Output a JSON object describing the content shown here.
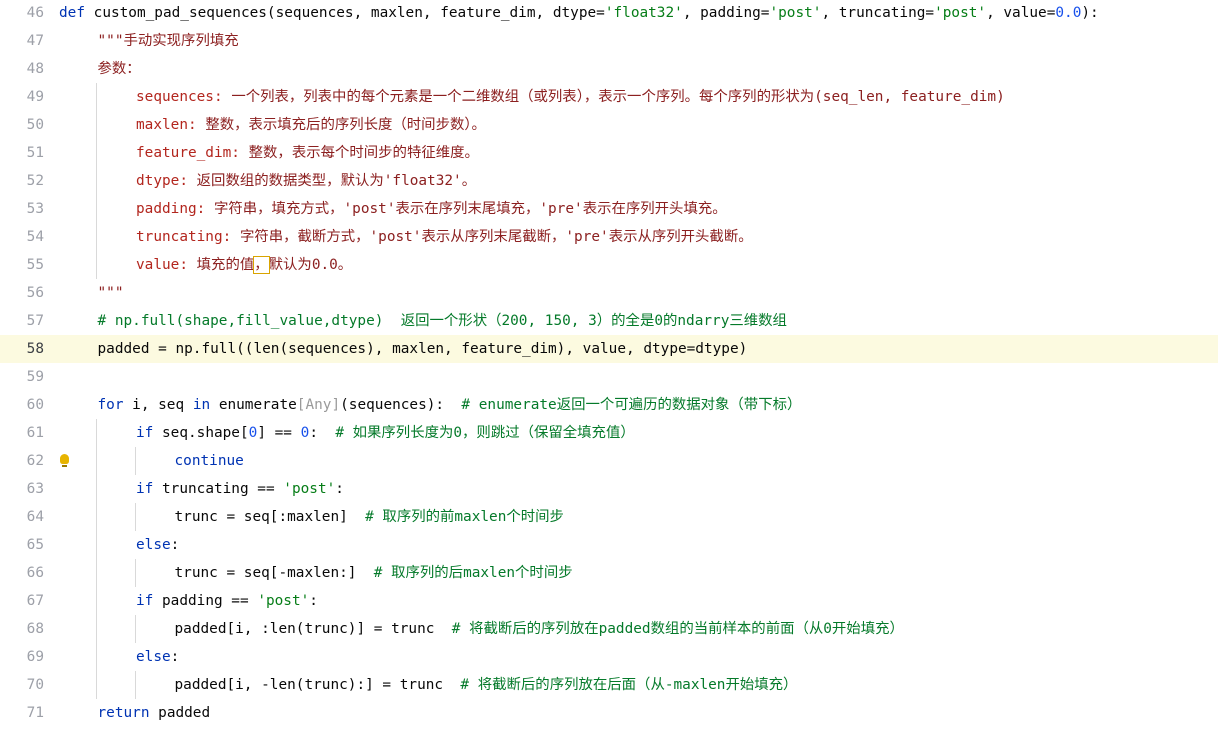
{
  "editor": {
    "current_line": 62,
    "lines": [
      {
        "num": "46",
        "indent": 0,
        "tokens": [
          {
            "t": "def ",
            "c": "kw"
          },
          {
            "t": "custom_pad_sequences(sequences, maxlen, feature_dim, dtype=",
            "c": "plain"
          },
          {
            "t": "'float32'",
            "c": "str"
          },
          {
            "t": ", padding=",
            "c": "plain"
          },
          {
            "t": "'post'",
            "c": "str"
          },
          {
            "t": ", truncating=",
            "c": "plain"
          },
          {
            "t": "'post'",
            "c": "str"
          },
          {
            "t": ", value=",
            "c": "plain"
          },
          {
            "t": "0.0",
            "c": "num"
          },
          {
            "t": "):",
            "c": "plain"
          }
        ]
      },
      {
        "num": "47",
        "indent": 1,
        "tokens": [
          {
            "t": "\"\"\"手动实现序列填充",
            "c": "doc"
          }
        ]
      },
      {
        "num": "48",
        "indent": 1,
        "tokens": [
          {
            "t": "参数：",
            "c": "doc"
          }
        ]
      },
      {
        "num": "49",
        "indent": 2,
        "tokens": [
          {
            "t": "sequences: ",
            "c": "dockey"
          },
          {
            "t": "一个列表，列表中的每个元素是一个二维数组（或列表），表示一个序列。每个序列的形状为(seq_len, feature_dim)",
            "c": "doc"
          }
        ]
      },
      {
        "num": "50",
        "indent": 2,
        "tokens": [
          {
            "t": "maxlen: ",
            "c": "dockey"
          },
          {
            "t": "整数，表示填充后的序列长度（时间步数）。",
            "c": "doc"
          }
        ]
      },
      {
        "num": "51",
        "indent": 2,
        "tokens": [
          {
            "t": "feature_dim: ",
            "c": "dockey"
          },
          {
            "t": "整数，表示每个时间步的特征维度。",
            "c": "doc"
          }
        ]
      },
      {
        "num": "52",
        "indent": 2,
        "tokens": [
          {
            "t": "dtype: ",
            "c": "dockey"
          },
          {
            "t": "返回数组的数据类型，默认为'float32'。",
            "c": "doc"
          }
        ]
      },
      {
        "num": "53",
        "indent": 2,
        "tokens": [
          {
            "t": "padding: ",
            "c": "dockey"
          },
          {
            "t": "字符串，填充方式，'post'表示在序列末尾填充，'pre'表示在序列开头填充。",
            "c": "doc"
          }
        ]
      },
      {
        "num": "54",
        "indent": 2,
        "tokens": [
          {
            "t": "truncating: ",
            "c": "dockey"
          },
          {
            "t": "字符串，截断方式，'post'表示从序列末尾截断，'pre'表示从序列开头截断。",
            "c": "doc"
          }
        ]
      },
      {
        "num": "55",
        "indent": 2,
        "tokens": [
          {
            "t": "value: ",
            "c": "dockey"
          },
          {
            "t": "填充的值",
            "c": "doc"
          },
          {
            "t": "，",
            "c": "doc",
            "box": true
          },
          {
            "t": "默认为0.0。",
            "c": "doc"
          }
        ]
      },
      {
        "num": "56",
        "indent": 1,
        "tokens": [
          {
            "t": "\"\"\"",
            "c": "doc"
          }
        ]
      },
      {
        "num": "57",
        "indent": 1,
        "tokens": [
          {
            "t": "# np.full(shape,fill_value,dtype)  返回一个形状（200, 150, 3）的全是0的ndarry三维数组",
            "c": "cmt"
          }
        ]
      },
      {
        "num": "58",
        "indent": 1,
        "highlight": true,
        "tokens": [
          {
            "t": "padded = np.full((len(sequences), maxlen, feature_dim), value, dtype=dtype)",
            "c": "plain"
          }
        ]
      },
      {
        "num": "59",
        "indent": 0,
        "tokens": []
      },
      {
        "num": "60",
        "indent": 1,
        "tokens": [
          {
            "t": "for ",
            "c": "kw"
          },
          {
            "t": "i, seq ",
            "c": "plain"
          },
          {
            "t": "in ",
            "c": "kw"
          },
          {
            "t": "enumerate",
            "c": "plain"
          },
          {
            "t": "[Any]",
            "c": "typehint"
          },
          {
            "t": "(sequences):  ",
            "c": "plain"
          },
          {
            "t": "# enumerate返回一个可遍历的数据对象（带下标）",
            "c": "cmt"
          }
        ]
      },
      {
        "num": "61",
        "indent": 2,
        "tokens": [
          {
            "t": "if ",
            "c": "kw"
          },
          {
            "t": "seq.shape[",
            "c": "plain"
          },
          {
            "t": "0",
            "c": "num"
          },
          {
            "t": "] == ",
            "c": "plain"
          },
          {
            "t": "0",
            "c": "num"
          },
          {
            "t": ":  ",
            "c": "plain"
          },
          {
            "t": "# 如果序列长度为0，则跳过（保留全填充值）",
            "c": "cmt"
          }
        ]
      },
      {
        "num": "62",
        "indent": 3,
        "tokens": [
          {
            "t": "continue",
            "c": "kw"
          }
        ]
      },
      {
        "num": "63",
        "indent": 2,
        "tokens": [
          {
            "t": "if ",
            "c": "kw"
          },
          {
            "t": "truncating == ",
            "c": "plain"
          },
          {
            "t": "'post'",
            "c": "str"
          },
          {
            "t": ":",
            "c": "plain"
          }
        ]
      },
      {
        "num": "64",
        "indent": 3,
        "tokens": [
          {
            "t": "trunc = seq[:maxlen]  ",
            "c": "plain"
          },
          {
            "t": "# 取序列的前maxlen个时间步",
            "c": "cmt"
          }
        ]
      },
      {
        "num": "65",
        "indent": 2,
        "tokens": [
          {
            "t": "else",
            "c": "kw"
          },
          {
            "t": ":",
            "c": "plain"
          }
        ]
      },
      {
        "num": "66",
        "indent": 3,
        "tokens": [
          {
            "t": "trunc = seq[-maxlen:]  ",
            "c": "plain"
          },
          {
            "t": "# 取序列的后maxlen个时间步",
            "c": "cmt"
          }
        ]
      },
      {
        "num": "67",
        "indent": 2,
        "tokens": [
          {
            "t": "if ",
            "c": "kw"
          },
          {
            "t": "padding == ",
            "c": "plain"
          },
          {
            "t": "'post'",
            "c": "str"
          },
          {
            "t": ":",
            "c": "plain"
          }
        ]
      },
      {
        "num": "68",
        "indent": 3,
        "tokens": [
          {
            "t": "padded[i, :len(trunc)] = trunc  ",
            "c": "plain"
          },
          {
            "t": "# 将截断后的序列放在padded数组的当前样本的前面（从0开始填充）",
            "c": "cmt"
          }
        ]
      },
      {
        "num": "69",
        "indent": 2,
        "tokens": [
          {
            "t": "else",
            "c": "kw"
          },
          {
            "t": ":",
            "c": "plain"
          }
        ]
      },
      {
        "num": "70",
        "indent": 3,
        "tokens": [
          {
            "t": "padded[i, -len(trunc):] = trunc  ",
            "c": "plain"
          },
          {
            "t": "# 将截断后的序列放在后面（从-maxlen开始填充）",
            "c": "cmt"
          }
        ]
      },
      {
        "num": "71",
        "indent": 1,
        "tokens": [
          {
            "t": "return ",
            "c": "kw"
          },
          {
            "t": "padded",
            "c": "plain"
          }
        ]
      }
    ]
  },
  "gutter_icons": {
    "line_62": "lightbulb-icon"
  }
}
